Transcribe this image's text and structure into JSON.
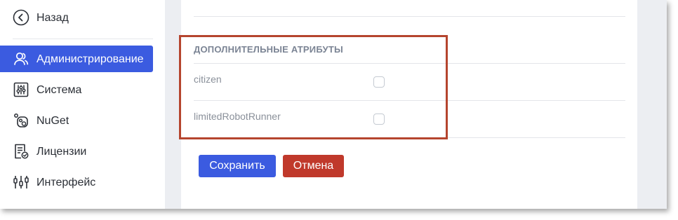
{
  "sidebar": {
    "back_label": "Назад",
    "items": [
      {
        "label": "Администрирование",
        "icon": "users-icon",
        "active": true
      },
      {
        "label": "Система",
        "icon": "sliders-icon",
        "active": false
      },
      {
        "label": "NuGet",
        "icon": "nuget-icon",
        "active": false
      },
      {
        "label": "Лицензии",
        "icon": "license-icon",
        "active": false
      },
      {
        "label": "Интерфейс",
        "icon": "equalizer-icon",
        "active": false
      }
    ]
  },
  "attributes_section": {
    "title": "ДОПОЛНИТЕЛЬНЫЕ АТРИБУТЫ",
    "attributes": [
      {
        "name": "citizen",
        "checked": false
      },
      {
        "name": "limitedRobotRunner",
        "checked": false
      }
    ]
  },
  "actions": {
    "save_label": "Сохранить",
    "cancel_label": "Отмена"
  },
  "colors": {
    "accent": "#3b5be0",
    "danger": "#c0392b",
    "highlight_border": "#b5452e"
  }
}
